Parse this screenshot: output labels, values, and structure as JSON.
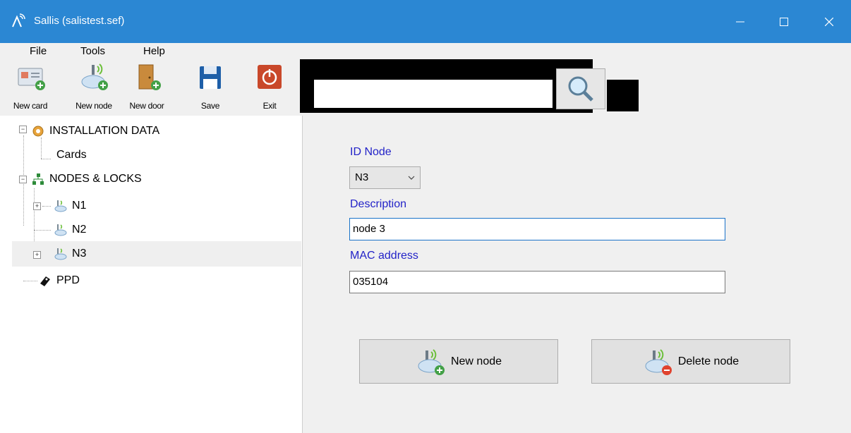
{
  "window": {
    "title": "Sallis (salistest.sef)"
  },
  "menu": {
    "items": [
      "File",
      "Tools",
      "Help"
    ]
  },
  "toolbar": {
    "new_card": "New card",
    "new_node": "New node",
    "new_door": "New door",
    "save": "Save",
    "exit": "Exit"
  },
  "search": {
    "value": "",
    "placeholder": ""
  },
  "tree": {
    "installation": "INSTALLATION DATA",
    "cards": "Cards",
    "nodes_locks": "NODES & LOCKS",
    "n1": "N1",
    "n2": "N2",
    "n3": "N3",
    "ppd": "PPD",
    "selected": "N3"
  },
  "form": {
    "id_node_label": "ID Node",
    "id_node_value": "N3",
    "description_label": "Description",
    "description_value": "node 3",
    "mac_label": "MAC address",
    "mac_value": "035104"
  },
  "buttons": {
    "new_node": "New node",
    "delete_node": "Delete node"
  },
  "colors": {
    "titlebar": "#2b87d3",
    "label_blue": "#2323c8",
    "selection": "#efefef"
  },
  "icons": {
    "app": "sallis-antenna-icon",
    "minimize": "minimize-icon",
    "maximize": "maximize-icon",
    "close": "close-icon",
    "new_card": "id-card-add-icon",
    "new_node": "router-add-icon",
    "new_door": "door-add-icon",
    "save": "floppy-disk-icon",
    "exit": "power-icon",
    "search": "magnifier-icon",
    "installation": "gears-icon",
    "nodes": "network-tree-icon",
    "node": "node-icon",
    "ppd": "ppd-device-icon",
    "delete_node": "router-delete-icon"
  }
}
